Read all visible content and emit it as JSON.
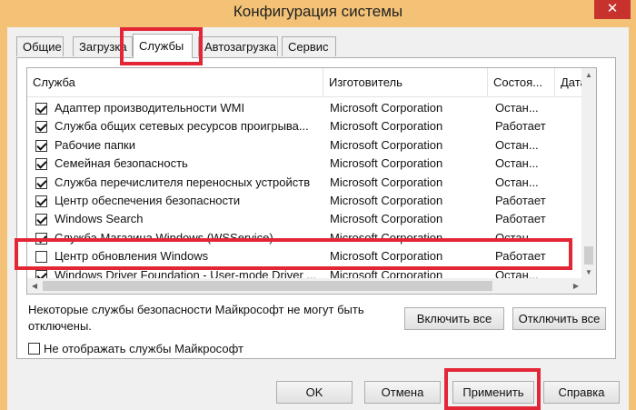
{
  "window": {
    "title": "Конфигурация системы",
    "close_glyph": "✕"
  },
  "tabs": [
    {
      "label": "Общие"
    },
    {
      "label": "Загрузка"
    },
    {
      "label": "Службы"
    },
    {
      "label": "Автозагрузка"
    },
    {
      "label": "Сервис"
    }
  ],
  "services": {
    "columns": [
      "Служба",
      "Изготовитель",
      "Состоя...",
      "Дата"
    ],
    "rows": [
      {
        "checked": true,
        "name": "Адаптер производительности WMI",
        "manufacturer": "Microsoft Corporation",
        "state": "Остан..."
      },
      {
        "checked": true,
        "name": "Служба общих сетевых ресурсов проигрыва...",
        "manufacturer": "Microsoft Corporation",
        "state": "Работает"
      },
      {
        "checked": true,
        "name": "Рабочие папки",
        "manufacturer": "Microsoft Corporation",
        "state": "Остан..."
      },
      {
        "checked": true,
        "name": "Семейная безопасность",
        "manufacturer": "Microsoft Corporation",
        "state": "Остан..."
      },
      {
        "checked": true,
        "name": "Служба перечислителя переносных устройств",
        "manufacturer": "Microsoft Corporation",
        "state": "Остан..."
      },
      {
        "checked": true,
        "name": "Центр обеспечения безопасности",
        "manufacturer": "Microsoft Corporation",
        "state": "Работает"
      },
      {
        "checked": true,
        "name": "Windows Search",
        "manufacturer": "Microsoft Corporation",
        "state": "Работает"
      },
      {
        "checked": true,
        "name": "Служба Магазина Windows (WSService)",
        "manufacturer": "Microsoft Corporation",
        "state": "Остан..."
      },
      {
        "checked": false,
        "name": "Центр обновления Windows",
        "manufacturer": "Microsoft Corporation",
        "state": "Работает"
      },
      {
        "checked": true,
        "name": "Windows Driver Foundation - User-mode Driver ...",
        "manufacturer": "Microsoft Corporation",
        "state": "Остан..."
      }
    ]
  },
  "notice": "Некоторые службы безопасности Майкрософт не могут быть отключены.",
  "enable_all": "Включить все",
  "disable_all": "Отключить все",
  "hide_ms": {
    "label": "Не отображать службы Майкрософт",
    "checked": false
  },
  "footer": {
    "ok": "OK",
    "cancel": "Отмена",
    "apply": "Применить",
    "help": "Справка"
  },
  "colors": {
    "title_bar": "#f3c276",
    "close_button": "#c7322d",
    "highlight_boxes": "#e32636"
  }
}
